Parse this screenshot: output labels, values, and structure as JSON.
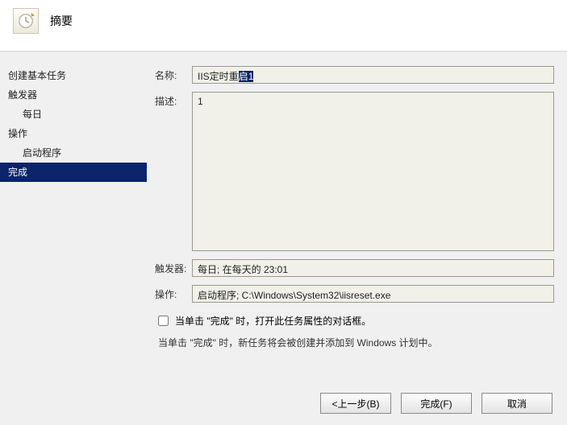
{
  "header": {
    "title": "摘要"
  },
  "sidebar": {
    "items": [
      {
        "label": "创建基本任务",
        "sub": false
      },
      {
        "label": "触发器",
        "sub": false
      },
      {
        "label": "每日",
        "sub": true
      },
      {
        "label": "操作",
        "sub": false
      },
      {
        "label": "启动程序",
        "sub": true
      },
      {
        "label": "完成",
        "sub": false,
        "selected": true
      }
    ]
  },
  "form": {
    "name_label": "名称:",
    "name_prefix": "IIS定时重",
    "name_selected": "启1",
    "desc_label": "描述:",
    "desc_value": "1",
    "trigger_label": "触发器:",
    "trigger_value": "每日; 在每天的 23:01",
    "action_label": "操作:",
    "action_value": "启动程序; C:\\Windows\\System32\\iisreset.exe",
    "checkbox_label": "当单击 \"完成\" 时，打开此任务属性的对话框。",
    "info_text": "当单击 \"完成\" 时，新任务将会被创建并添加到 Windows 计划中。"
  },
  "buttons": {
    "back": "<上一步(B)",
    "finish": "完成(F)",
    "cancel": "取消"
  }
}
